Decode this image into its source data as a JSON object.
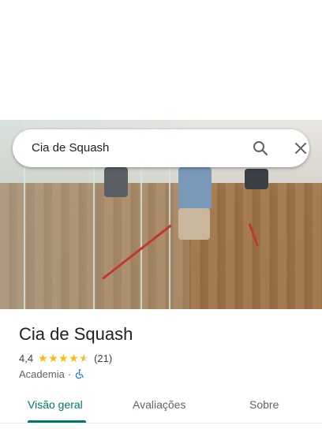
{
  "search": {
    "query": "Cia de Squash"
  },
  "place": {
    "name": "Cia de Squash",
    "rating": "4,4",
    "stars_filled": 4.4,
    "review_count": "(21)",
    "category": "Academia",
    "separator": "·"
  },
  "tabs": [
    {
      "label": "Visão geral",
      "active": true
    },
    {
      "label": "Avaliações",
      "active": false
    },
    {
      "label": "Sobre",
      "active": false
    }
  ],
  "colors": {
    "accent": "#00796b",
    "star": "#fbbc04",
    "wheelchair": "#1a73e8"
  },
  "icons": {
    "search": "search-icon",
    "close": "close-icon",
    "accessibility": "wheelchair-icon"
  }
}
